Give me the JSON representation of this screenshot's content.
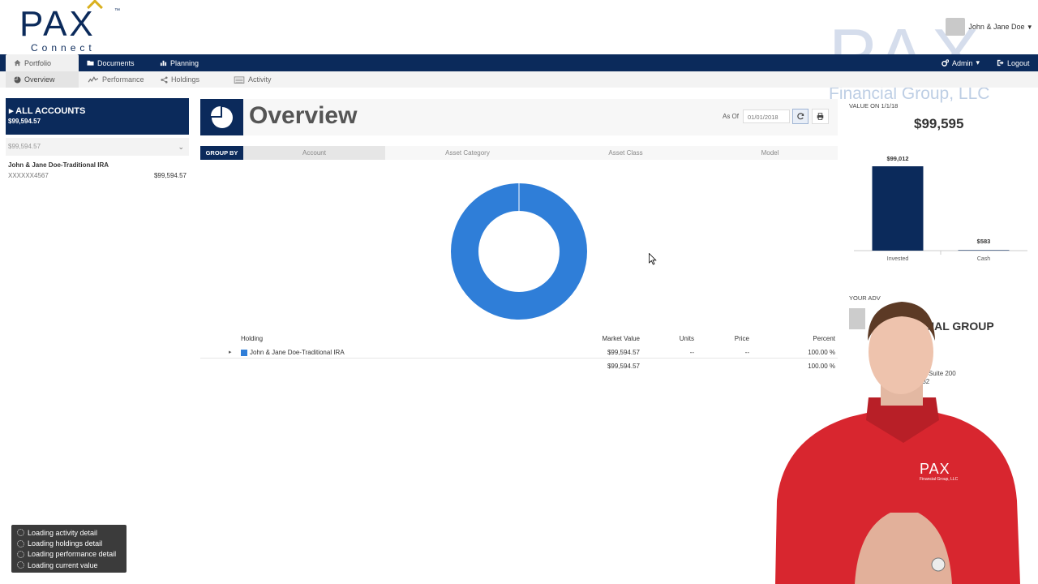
{
  "brand": {
    "logo_text": "PAX",
    "logo_sub": "Connect",
    "tm": "™"
  },
  "watermark": {
    "big": "PAX",
    "small": "Financial Group, LLC"
  },
  "user": {
    "name": "John & Jane Doe"
  },
  "topnav": {
    "portfolio": "Portfolio",
    "documents": "Documents",
    "planning": "Planning",
    "admin": "Admin",
    "logout": "Logout"
  },
  "subnav": {
    "overview": "Overview",
    "performance": "Performance",
    "holdings": "Holdings",
    "activity": "Activity"
  },
  "accounts": {
    "header": "ALL ACCOUNTS",
    "header_value": "$99,594.57",
    "sub_value": "$99,594.57",
    "items": [
      {
        "name": "John & Jane Doe-Traditional IRA",
        "number": "XXXXXX4567",
        "value": "$99,594.57"
      }
    ]
  },
  "overview": {
    "title": "Overview",
    "as_of_label": "As Of",
    "as_of_value": "01/01/2018"
  },
  "group_by": {
    "label": "GROUP BY",
    "options": [
      "Account",
      "Asset Category",
      "Asset Class",
      "Model"
    ],
    "selected": "Account"
  },
  "holdings_table": {
    "headers": {
      "holding": "Holding",
      "market_value": "Market Value",
      "units": "Units",
      "price": "Price",
      "percent": "Percent"
    },
    "rows": [
      {
        "holding": "John & Jane Doe-Traditional IRA",
        "market_value": "$99,594.57",
        "units": "--",
        "price": "--",
        "percent": "100.00 %",
        "color": "#2f7ed8"
      }
    ],
    "total": {
      "market_value": "$99,594.57",
      "percent": "100.00 %"
    }
  },
  "value_panel": {
    "label": "VALUE ON 1/1/18",
    "value": "$99,595"
  },
  "chart_data": {
    "type": "bar",
    "categories": [
      "Invested",
      "Cash"
    ],
    "values": [
      99012,
      583
    ],
    "data_labels": [
      "$99,012",
      "$583"
    ],
    "ylim": [
      0,
      99012
    ],
    "grid": false,
    "colors": {
      "bar": "#0b2a5b"
    }
  },
  "donut": {
    "slices": [
      {
        "name": "John & Jane Doe-Traditional IRA",
        "value": 100,
        "color": "#2f7ed8"
      }
    ]
  },
  "advisor": {
    "label": "YOUR ADV",
    "name": "NCIAL GROUP",
    "addr1": "04 E. Suite 200",
    "addr2": "78232"
  },
  "shirt_logo": {
    "text": "PAX",
    "sub": "Financial Group, LLC"
  },
  "loading": [
    "Loading activity detail",
    "Loading holdings detail",
    "Loading performance detail",
    "Loading current value"
  ],
  "colors": {
    "navy": "#0b2a5b",
    "accent_blue": "#2f7ed8",
    "gold": "#d9b01e"
  }
}
